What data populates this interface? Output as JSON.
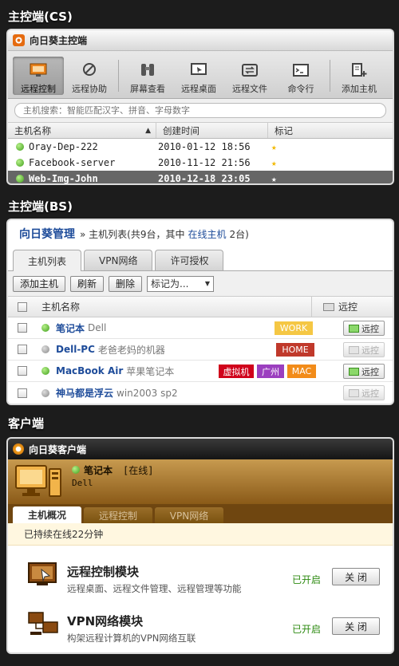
{
  "sections": {
    "cs": "主控端(CS)",
    "bs": "主控端(BS)",
    "client": "客户端"
  },
  "cs": {
    "title": "向日葵主控端",
    "toolbar": [
      "远程控制",
      "远程协助",
      "屏幕查看",
      "远程桌面",
      "远程文件",
      "命令行",
      "添加主机"
    ],
    "search_placeholder": "主机搜索：智能匹配汉字、拼音、字母数字",
    "columns": [
      "主机名称",
      "创建时间",
      "标记"
    ],
    "rows": [
      {
        "name": "Oray-Dep-222",
        "time": "2010-01-12 18:56"
      },
      {
        "name": "Facebook-server",
        "time": "2010-11-12 21:56"
      },
      {
        "name": "Web-Img-John",
        "time": "2010-12-18 23:05"
      }
    ],
    "star": "★"
  },
  "bs": {
    "brand": "向日葵管理",
    "crumb_pre": "» 主机列表(共9台，其中",
    "crumb_link": "在线主机",
    "crumb_post": "2台)",
    "tabs": [
      "主机列表",
      "VPN网络",
      "许可授权"
    ],
    "buttons": [
      "添加主机",
      "刷新",
      "删除"
    ],
    "mark_select": "标记为...",
    "col_name": "主机名称",
    "col_remote": "远控",
    "rows": [
      {
        "name": "笔记本",
        "desc": "Dell",
        "tags": [
          {
            "text": "WORK",
            "color": "#f5c744"
          }
        ],
        "online": true
      },
      {
        "name": "Dell-PC",
        "desc": "老爸老妈的机器",
        "tags": [
          {
            "text": "HOME",
            "color": "#c0392b"
          }
        ],
        "online": false
      },
      {
        "name": "MacBook Air",
        "desc": "苹果笔记本",
        "tags": [
          {
            "text": "虚拟机",
            "color": "#d0021b"
          },
          {
            "text": "广州",
            "color": "#9b3fbf"
          },
          {
            "text": "MAC",
            "color": "#f28c1a"
          }
        ],
        "online": true
      },
      {
        "name": "神马都是浮云",
        "desc": "win2003 sp2",
        "tags": [],
        "online": false
      }
    ],
    "remote_label": "远控"
  },
  "client": {
    "title": "向日葵客户端",
    "host": "笔记本",
    "status": "[在线]",
    "sub": "Dell",
    "tabs": [
      "主机概况",
      "远程控制",
      "VPN网络"
    ],
    "uptime": "已持续在线22分钟",
    "modules": [
      {
        "title": "远程控制模块",
        "desc": "远程桌面、远程文件管理、远程管理等功能",
        "state": "已开启",
        "button": "关 闭"
      },
      {
        "title": "VPN网络模块",
        "desc": "构架远程计算机的VPN网络互联",
        "state": "已开启",
        "button": "关 闭"
      }
    ]
  }
}
